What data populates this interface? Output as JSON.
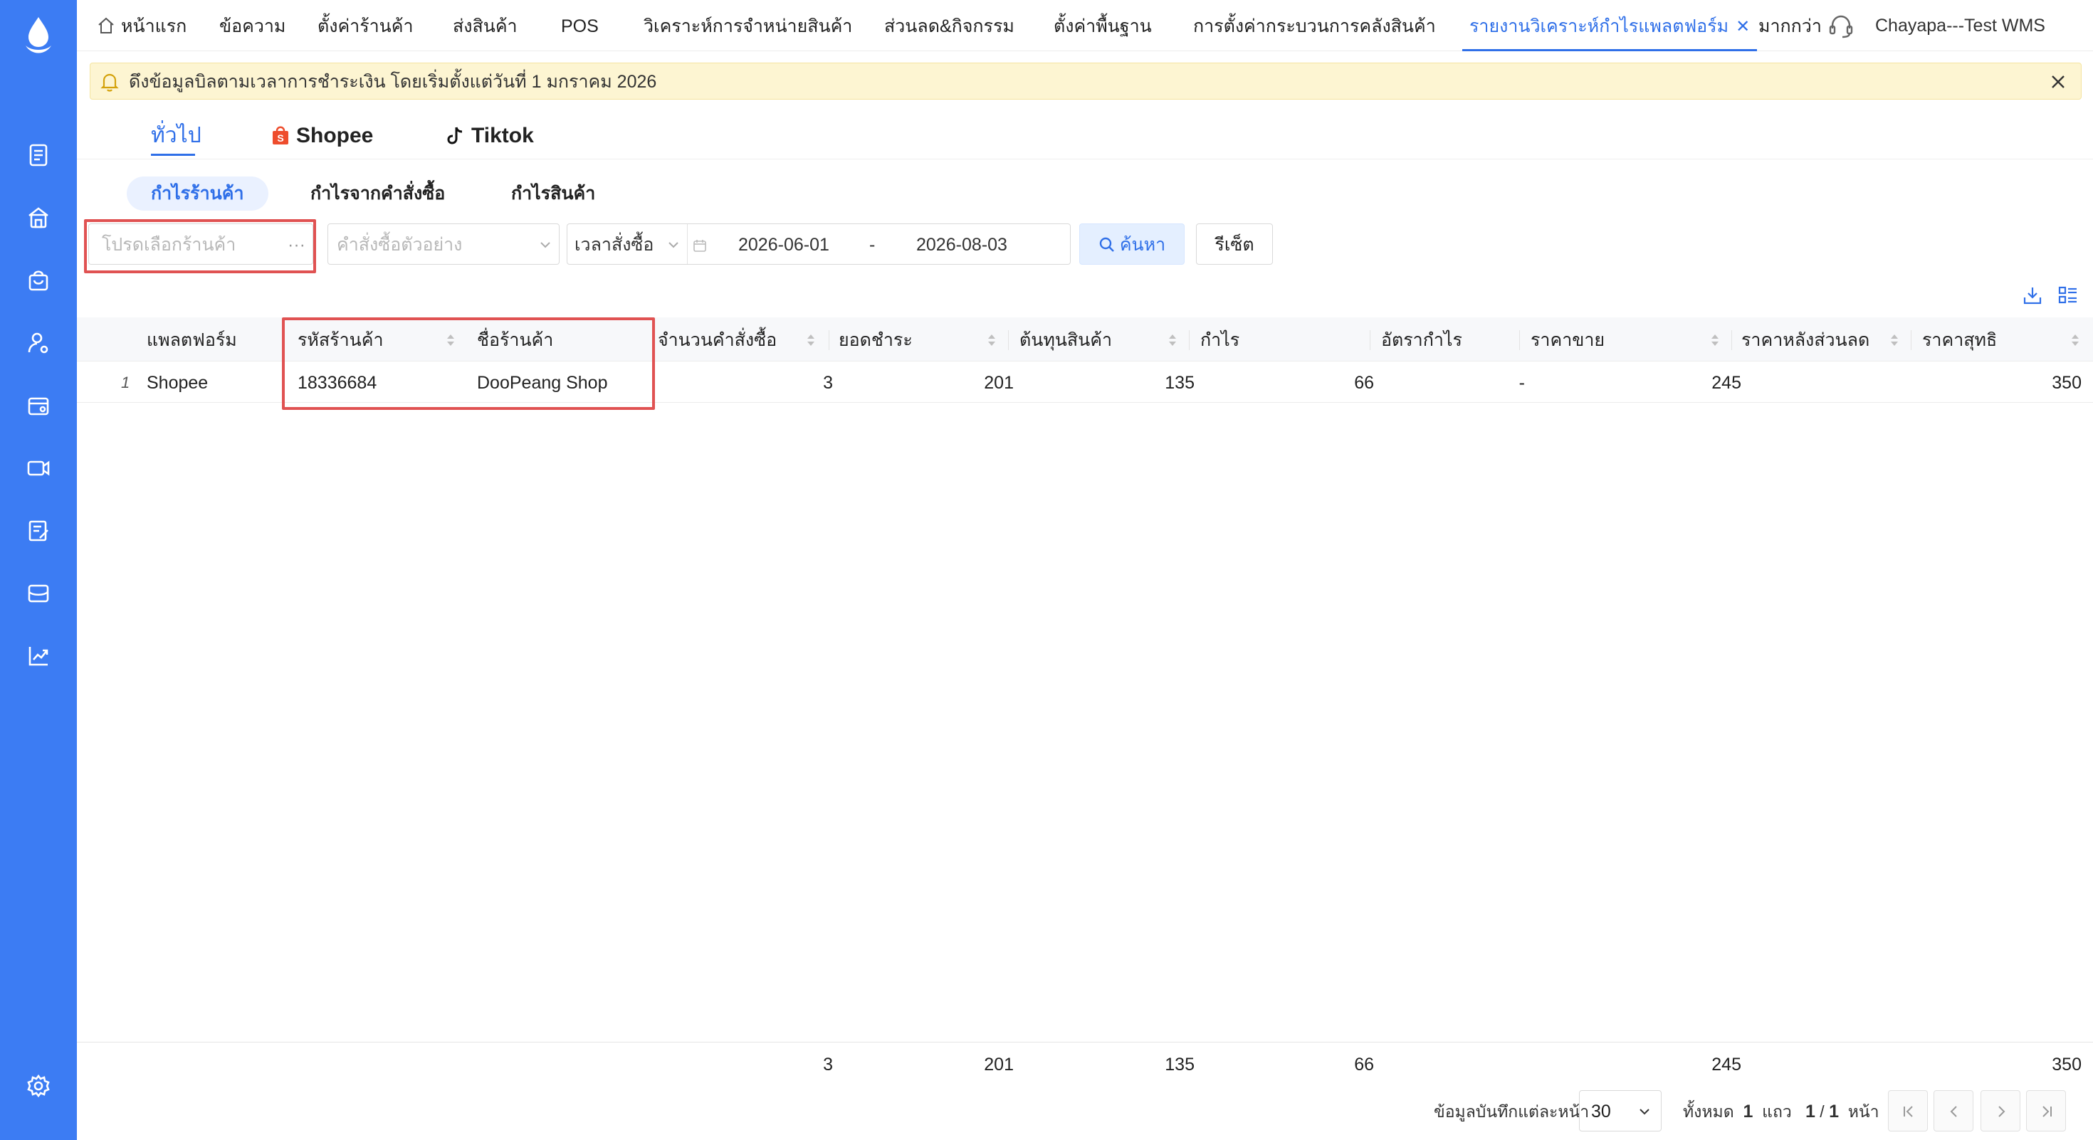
{
  "nav": {
    "tabs": [
      "หน้าแรก",
      "ข้อความ",
      "ตั้งค่าร้านค้า",
      "ส่งสินค้า",
      "POS",
      "วิเคราะห์การจำหน่ายสินค้า",
      "ส่วนลด&กิจกรรม",
      "ตั้งค่าพื้นฐาน",
      "การตั้งค่ากระบวนการคลังสินค้า",
      "รายงานวิเคราะห์กำไรแพลตฟอร์ม"
    ],
    "more": "มากกว่า",
    "user": "Chayapa---Test WMS",
    "active_tab_index": 9
  },
  "notice": {
    "text": "ดึงข้อมูลบิลตามเวลาการชำระเงิน โดยเริ่มตั้งแต่วันที่ 1 มกราคม 2026"
  },
  "platform_tabs": [
    "ทั่วไป",
    "Shopee",
    "Tiktok"
  ],
  "sub_tabs": [
    "กำไรร้านค้า",
    "กำไรจากคำสั่งซื้อ",
    "กำไรสินค้า"
  ],
  "filters": {
    "shop_placeholder": "โปรดเลือกร้านค้า",
    "shop_more": "···",
    "order_example_placeholder": "คำสั่งซื้อตัวอย่าง",
    "time_type": "เวลาสั่งซื้อ",
    "date_start": "2026-06-01",
    "date_sep": "-",
    "date_end": "2026-08-03",
    "search_label": "ค้นหา",
    "reset_label": "รีเซ็ต"
  },
  "table": {
    "columns": [
      "แพลตฟอร์ม",
      "รหัสร้านค้า",
      "ชื่อร้านค้า",
      "จำนวนคำสั่งซื้อ",
      "ยอดชำระ",
      "ต้นทุนสินค้า",
      "กำไร",
      "อัตรากำไร",
      "ราคาขาย",
      "ราคาหลังส่วนลด",
      "ราคาสุทธิ"
    ],
    "rows": [
      [
        "1",
        "Shopee",
        "18336684",
        "DooPeang Shop",
        "3",
        "201",
        "135",
        "66",
        "-",
        "245",
        "350"
      ]
    ],
    "totals": {
      "orders": "3",
      "paid": "201",
      "cost": "135",
      "profit": "66",
      "sale_price": "245",
      "net_price": "350"
    }
  },
  "pagination": {
    "per_page_label": "ข้อมูลบันทึกแต่ละหน้า",
    "per_page": "30",
    "total_label": "ทั้งหมด",
    "total_rows": "1",
    "rows_unit": "แถว",
    "current_page": "1",
    "page_sep": "/",
    "total_pages": "1",
    "page_unit": "หน้า"
  },
  "colors": {
    "sidebar": "#3c7cf3",
    "accent": "#2f6fe8",
    "highlight_box": "#e05252",
    "notice_bg": "#fdf5d2"
  }
}
